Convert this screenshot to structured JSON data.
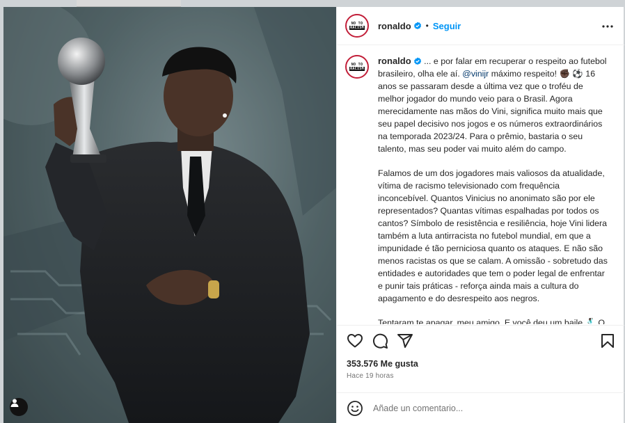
{
  "colors": {
    "accent": "#0095f6",
    "text": "#262626",
    "secondary_text": "#737373",
    "border": "#efefef",
    "avatar_ring": "#c21f39",
    "mention": "#00376b"
  },
  "photo": {
    "description_icon": "user-tags-icon"
  },
  "header": {
    "avatar_icon": "no-to-racism-logo",
    "username": "ronaldo",
    "verified_icon": "verified-badge-icon",
    "separator": "•",
    "follow_label": "Seguir",
    "more_icon": "more-options-icon"
  },
  "caption": {
    "username": "ronaldo",
    "para1_a": "... e por falar em recuperar o respeito ao futebol brasileiro, olha ele aí. ",
    "mention": "@vinijr",
    "para1_b": " máximo respeito! ",
    "emoji_hand": "✊🏿",
    "emoji_ball": "⚽",
    "para1_c": " 16 anos se passaram desde a última vez que o troféu de melhor jogador do mundo veio para o Brasil. Agora merecidamente nas mãos do Vini, significa muito mais que seu papel decisivo nos jogos e os números extraordinários na temporada 2023/24. Para o prêmio, bastaria o seu talento, mas seu poder vai muito além do campo.",
    "para2": "Falamos de um dos jogadores mais valiosos da atualidade, vítima de racismo televisionado com frequência inconcebível. Quantos Vinicius no anonimato são por ele representados? Quantas vítimas espalhadas por todos os cantos? Símbolo de resistência e resiliência, hoje Vini lidera também a luta antirracista no futebol mundial, em que a impunidade é tão perniciosa quanto os ataques. E não são menos racistas os que se calam. A omissão - sobretudo das entidades e autoridades que tem o poder legal de enfrentar e punir tais práticas - reforça ainda mais a cultura do apagamento e do desrespeito aos negros.",
    "para3_a": "Tentaram te apagar, meu amigo. E você deu um baile.",
    "emoji_dancer": "🕺🏿",
    "para3_b": " O MELHOR JOGADOR DO MUNDO É PRETO E BRASILEIRO!"
  },
  "actions": {
    "like_icon": "heart-icon",
    "comment_icon": "comment-icon",
    "share_icon": "share-icon",
    "save_icon": "bookmark-icon"
  },
  "stats": {
    "likes": "353.576 Me gusta",
    "time": "Hace 19 horas"
  },
  "comment": {
    "emoji_icon": "emoji-icon",
    "placeholder": "Añade un comentario...",
    "publish_label": ""
  }
}
